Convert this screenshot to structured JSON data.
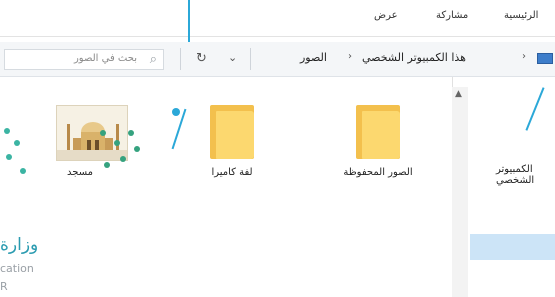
{
  "ribbon": {
    "tabs": [
      "الرئيسية",
      "مشاركة",
      "عرض"
    ]
  },
  "addressbar": {
    "breadcrumbs": [
      "هذا الكمبيوتر الشخصي",
      "الصور"
    ],
    "search_placeholder": "بحث في الصور",
    "refresh_icon": "refresh-icon",
    "dropdown_icon": "chevron-down-icon"
  },
  "files": [
    {
      "name": "الصور المحفوظة",
      "type": "folder"
    },
    {
      "name": "لفة كاميرا",
      "type": "folder"
    },
    {
      "name": "مسجد",
      "type": "image"
    }
  ],
  "nav_pane": {
    "items": [
      "الكمبيوتر الشخصي"
    ]
  },
  "watermark": {
    "title": "وزارة",
    "subtitle": "cation",
    "letter": "R"
  },
  "colors": {
    "accent": "#2ba8d8",
    "folder": "#fcd86f",
    "selection": "#cce4f7"
  }
}
